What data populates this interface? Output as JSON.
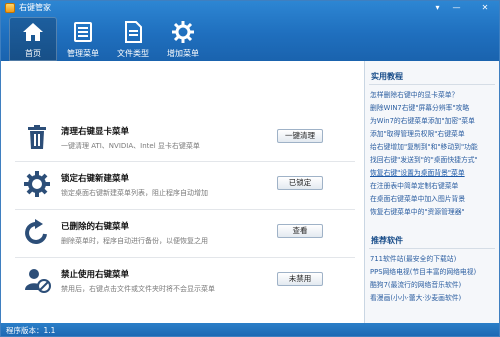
{
  "app": {
    "title": "右键管家",
    "version": "程序版本：1.1"
  },
  "window_controls": {
    "menu": "▾",
    "minimize": "—",
    "close": "✕"
  },
  "nav": [
    {
      "label": "首页",
      "icon": "home-icon",
      "active": true
    },
    {
      "label": "管理菜单",
      "icon": "list-icon",
      "active": false
    },
    {
      "label": "文件类型",
      "icon": "file-type-icon",
      "active": false
    },
    {
      "label": "增加菜单",
      "icon": "gear-icon",
      "active": false
    }
  ],
  "rows": [
    {
      "title": "清理右键显卡菜单",
      "desc": "一键清理 ATI、NVIDIA、Intel 显卡右键菜单",
      "button": "一键清理",
      "icon": "trash-icon"
    },
    {
      "title": "锁定右键新建菜单",
      "desc": "锁定桌面右键新建菜单列表，阻止程序自动增加",
      "button": "已锁定",
      "icon": "gear-lock-icon"
    },
    {
      "title": "已删除的右键菜单",
      "desc": "删除菜单时，程序自动进行备份，以便恢复之用",
      "button": "查看",
      "icon": "restore-icon"
    },
    {
      "title": "禁止使用右键菜单",
      "desc": "禁用后，右键点击文件或文件夹时将不会显示菜单",
      "button": "未禁用",
      "icon": "user-block-icon"
    }
  ],
  "side": {
    "tutorials_title": "实用教程",
    "tutorials": [
      "怎样删除右键中的显卡菜单？",
      "删除WIN7右键\"屏幕分辨率\"攻略",
      "为Win7的右键菜单添加\"加密\"菜单",
      "添加\"取得管理员权限\"右键菜单",
      "给右键增加\"复制到\"和\"移动到\"功能",
      "找回右键\"发送到\"的\"桌面快捷方式\"",
      "恢复右键\"设置为桌面背景\"菜单",
      "在注册表中简单定制右键菜单",
      "在桌面右键菜单中加入图片背景",
      "恢复右键菜单中的\"资源管理器\""
    ],
    "software_title": "推荐软件",
    "software": [
      "711软件站(最安全的下载站)",
      "PPS网络电视(节目丰富的网络电视)",
      "酷狗7(最流行的网络音乐软件)",
      "看漫画(小小·蕾大·沙麦画软件)"
    ]
  },
  "colors": {
    "header": "#1f6fbe",
    "link": "#2a5da0",
    "accent": "#1a4e8a"
  }
}
